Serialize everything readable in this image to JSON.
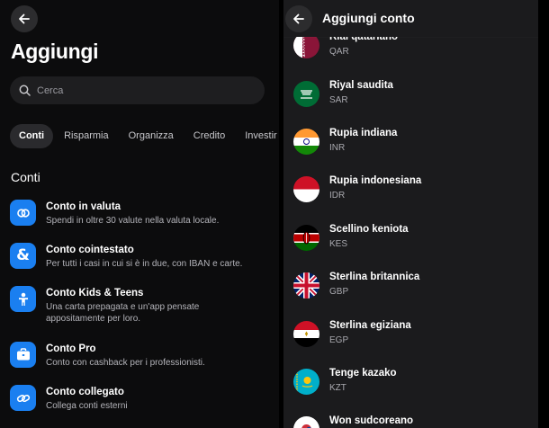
{
  "left_panel": {
    "title": "Aggiungi",
    "search": {
      "placeholder": "Cerca",
      "value": ""
    },
    "tabs": [
      {
        "label": "Conti",
        "active": true
      },
      {
        "label": "Risparmia",
        "active": false
      },
      {
        "label": "Organizza",
        "active": false
      },
      {
        "label": "Credito",
        "active": false
      },
      {
        "label": "Investir",
        "active": false
      }
    ],
    "section_title": "Conti",
    "accounts": [
      {
        "title": "Conto in valuta",
        "subtitle": "Spendi in oltre 30 valute nella valuta locale.",
        "icon": "currency-exchange-icon"
      },
      {
        "title": "Conto cointestato",
        "subtitle": "Per tutti i casi in cui si è in due, con IBAN e carte.",
        "icon": "ampersand-icon"
      },
      {
        "title": "Conto Kids & Teens",
        "subtitle": "Una carta prepagata e un'app pensate appositamente per loro.",
        "icon": "child-icon"
      },
      {
        "title": "Conto Pro",
        "subtitle": "Conto con cashback per i professionisti.",
        "icon": "briefcase-icon"
      },
      {
        "title": "Conto collegato",
        "subtitle": "Collega conti esterni",
        "icon": "link-icon"
      }
    ]
  },
  "right_panel": {
    "title": "Aggiungi conto",
    "currencies": [
      {
        "name": "Rial qatariano",
        "code": "QAR",
        "flag": "qatar-flag-icon"
      },
      {
        "name": "Riyal saudita",
        "code": "SAR",
        "flag": "saudi-arabia-flag-icon"
      },
      {
        "name": "Rupia indiana",
        "code": "INR",
        "flag": "india-flag-icon"
      },
      {
        "name": "Rupia indonesiana",
        "code": "IDR",
        "flag": "indonesia-flag-icon"
      },
      {
        "name": "Scellino keniota",
        "code": "KES",
        "flag": "kenya-flag-icon"
      },
      {
        "name": "Sterlina britannica",
        "code": "GBP",
        "flag": "uk-flag-icon"
      },
      {
        "name": "Sterlina egiziana",
        "code": "EGP",
        "flag": "egypt-flag-icon"
      },
      {
        "name": "Tenge kazako",
        "code": "KZT",
        "flag": "kazakhstan-flag-icon"
      },
      {
        "name": "Won sudcoreano",
        "code": "",
        "flag": "south-korea-flag-icon"
      }
    ]
  },
  "colors": {
    "accent": "#1a7ff0",
    "background": "#0c0c0d",
    "panel": "#1b1b1d"
  }
}
